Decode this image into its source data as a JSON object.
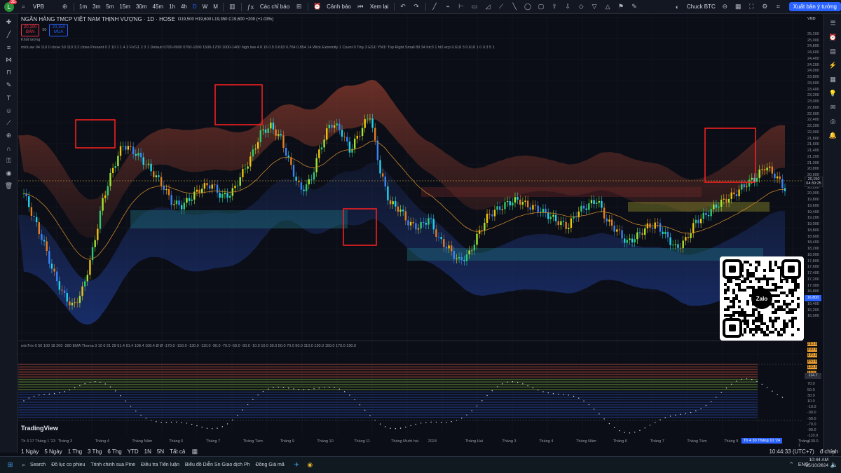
{
  "topbar": {
    "symbol": "VPB",
    "logo_badge": "35",
    "intervals": [
      "1m",
      "3m",
      "5m",
      "15m",
      "30m",
      "45m",
      "1h",
      "4h",
      "D",
      "W",
      "M"
    ],
    "active_interval": "D",
    "indicators_label": "Các chỉ báo",
    "alert_label": "Cảnh báo",
    "replay_label": "Xem lại",
    "user_label": "Chuck BTC",
    "user_sub": "—",
    "publish_label": "Xuất bản ý tưởng"
  },
  "legend": {
    "title": "NGÂN HÀNG TMCP VIỆT NAM THỊNH VƯỢNG · 1D · HOSE",
    "ohlc": "O19,500 H19,600 L19,350 C19,600 +200 (+1.03%)",
    "sell_price": "20,100",
    "sell_label": "BÁN",
    "spread": "50",
    "buy_price": "20,150",
    "buy_label": "MUA",
    "volume_label": "Khối lượng",
    "indicator_1": "mInLaw 94 110 0 close 50 110 3.2 close Present 0 2 10 1 1 4 2 FVG1 2 3 1 Default 0700-0900 0700-1000 1500-1700 1000-1400 high low 4 8 16 0.5 0.618 0.704 0.854 14 Wick Extremity 1 Count 0 Tiny 3 ES1! YM1! Top Right Small 89 34 htc3 1 ht2 ecp 0.618 3 0.618 1 0 0.3 5 1"
  },
  "price_scale": {
    "currency": "VND",
    "levels": [
      "25,200",
      "25,000",
      "24,800",
      "24,600",
      "24,400",
      "24,200",
      "24,000",
      "23,800",
      "23,600",
      "23,400",
      "23,200",
      "23,000",
      "22,800",
      "22,600",
      "22,400",
      "22,200",
      "22,000",
      "21,800",
      "21,600",
      "21,400",
      "21,200",
      "21,000",
      "20,800",
      "20,600",
      "20,400",
      "20,200",
      "20,000",
      "19,800",
      "19,600",
      "19,400",
      "19,200",
      "19,000",
      "18,800",
      "18,600",
      "18,400",
      "18,200",
      "18,000",
      "17,800",
      "17,600",
      "17,400",
      "17,200",
      "17,000",
      "16,800",
      "16,600",
      "16,400",
      "16,200",
      "16,000"
    ],
    "last_price": "20,150",
    "countdown": "04:30:25",
    "lower_marker": "16,800",
    "osc_levels": [
      "210.0",
      "190.0",
      "170.0",
      "150.0",
      "130.0",
      "110.0",
      "90.0",
      "70.0",
      "50.0",
      "30.0",
      "10.0",
      "-10.0",
      "-30.0",
      "-50.0",
      "-70.0",
      "-90.0",
      "-110.0",
      "-130.0"
    ],
    "osc_marker": "114.7"
  },
  "chart_data": {
    "type": "candlestick",
    "title": "NGÂN HÀNG TMCP VIỆT NAM THỊNH VƯỢNG · 1D · HOSE",
    "ylim": [
      15800,
      25400
    ],
    "last": 20150,
    "approx_closes": [
      20000,
      19200,
      18400,
      17400,
      16700,
      16300,
      16900,
      18200,
      19800,
      20800,
      21600,
      21400,
      21100,
      20700,
      20300,
      19700,
      19600,
      19900,
      20200,
      20300,
      19900,
      20000,
      20600,
      21200,
      22000,
      22200,
      21800,
      20900,
      20100,
      20400,
      21500,
      22300,
      22100,
      21400,
      22000,
      22600,
      20800,
      19700,
      19500,
      19000,
      18900,
      19200,
      18500,
      18200,
      17800,
      18000,
      18700,
      19300,
      19500,
      19700,
      19800,
      19600,
      19500,
      19300,
      19100,
      18900,
      19400,
      19600,
      19800,
      19100,
      18800,
      18400,
      18600,
      18900,
      19000,
      18600,
      18200,
      18500,
      19100,
      19300,
      19600,
      19800,
      20000,
      20300,
      20500,
      20900,
      20600,
      20150
    ],
    "grid": true,
    "legend_position": "top-left"
  },
  "oscillator": {
    "legend": "mInTrix 0 50 100 18 200 -280 EMA Thoma 3 10 0 21 28 91.4 91.4 108.4 108.4 Ø Ø -170.0 -150.0 -130.0 -110.0 -90.0 -70.0 -50.0 -30.0 -10.0 10.0 30.0 50.0 70.0 90.0 110.0 130.0 150.0 170.0 190.0"
  },
  "time_axis": {
    "labels": [
      "Th 3 17 Tháng 1 '23",
      "Tháng 3",
      "Tháng 4",
      "Tháng Năm",
      "Tháng 6",
      "Tháng 7",
      "Tháng Tám",
      "Tháng 9",
      "Tháng 10",
      "Tháng 11",
      "Tháng Mười hai",
      "2024",
      "Tháng Hai",
      "Tháng 3",
      "Tháng 4",
      "Tháng Năm",
      "Tháng 6",
      "Tháng 7",
      "Tháng Tám",
      "Tháng 9",
      "Tháng 10",
      "Tháng 1"
    ],
    "selected": "Th 4 30 Tháng 10 '24"
  },
  "range_tabs": [
    "1 Ngày",
    "5 Ngày",
    "1 Thg",
    "3 Thg",
    "6 Thg",
    "YTD",
    "1N",
    "5N",
    "Tất cả"
  ],
  "bottom_right": {
    "time": "10:44:33 (UTC+7)",
    "mode": "đ chính"
  },
  "tv_logo": "TradingView",
  "qr_label": "Zalo",
  "taskbar": {
    "search": "Search",
    "items": [
      "Đồ lục co phieu",
      "Trinh chinh sua Pine",
      "Điều tra Tiến luận",
      "Biểu đồ Diễn Sn Giao dịch Ph",
      "Đồng Giá mã"
    ],
    "lang": "ENG",
    "time": "10:44 AM",
    "date": "25/10/2024"
  }
}
